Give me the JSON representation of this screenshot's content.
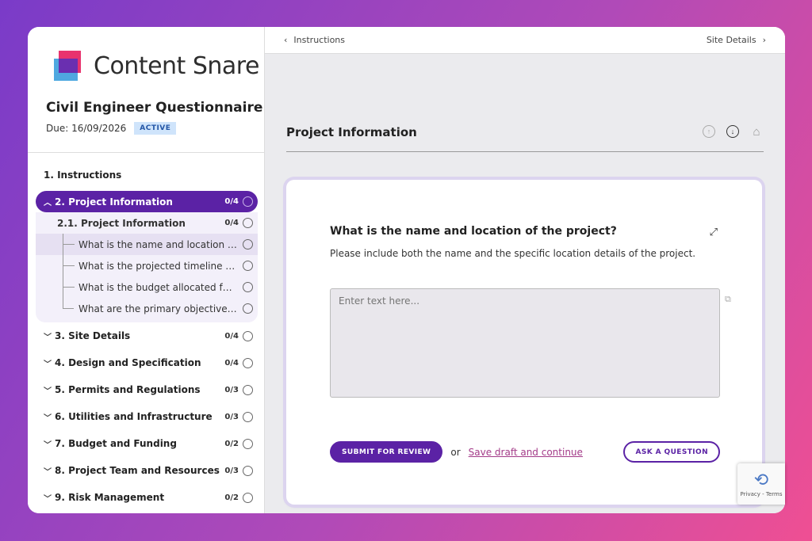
{
  "brand": {
    "name": "Content Snare"
  },
  "questionnaire": {
    "title": "Civil Engineer Questionnaire",
    "due": "Due: 16/09/2026",
    "status": "ACTIVE"
  },
  "sidebar": {
    "instructions": "1. Instructions",
    "active_section": {
      "label": "2. Project Information",
      "count": "0/4"
    },
    "subsection": {
      "label": "2.1. Project Information",
      "count": "0/4"
    },
    "questions": [
      "What is the name and location of t...",
      "What is the projected timeline for ...",
      "What is the budget allocated for t...",
      "What are the primary objectives of..."
    ],
    "sections": [
      {
        "label": "3. Site Details",
        "count": "0/4"
      },
      {
        "label": "4. Design and Specification",
        "count": "0/4"
      },
      {
        "label": "5. Permits and Regulations",
        "count": "0/3"
      },
      {
        "label": "6. Utilities and Infrastructure",
        "count": "0/3"
      },
      {
        "label": "7. Budget and Funding",
        "count": "0/2"
      },
      {
        "label": "8. Project Team and Resources",
        "count": "0/3"
      },
      {
        "label": "9. Risk Management",
        "count": "0/2"
      }
    ]
  },
  "topbar": {
    "prev": "Instructions",
    "next": "Site Details"
  },
  "main": {
    "section_title": "Project Information",
    "question": "What is the name and location of the project?",
    "description": "Please include both the name and the specific location details of the project.",
    "answer_placeholder": "Enter text here...",
    "submit_label": "SUBMIT FOR REVIEW",
    "or_text": "or",
    "save_link": "Save draft and continue",
    "ask_label": "ASK A QUESTION"
  },
  "recaptcha": {
    "text": "Privacy - Terms"
  }
}
